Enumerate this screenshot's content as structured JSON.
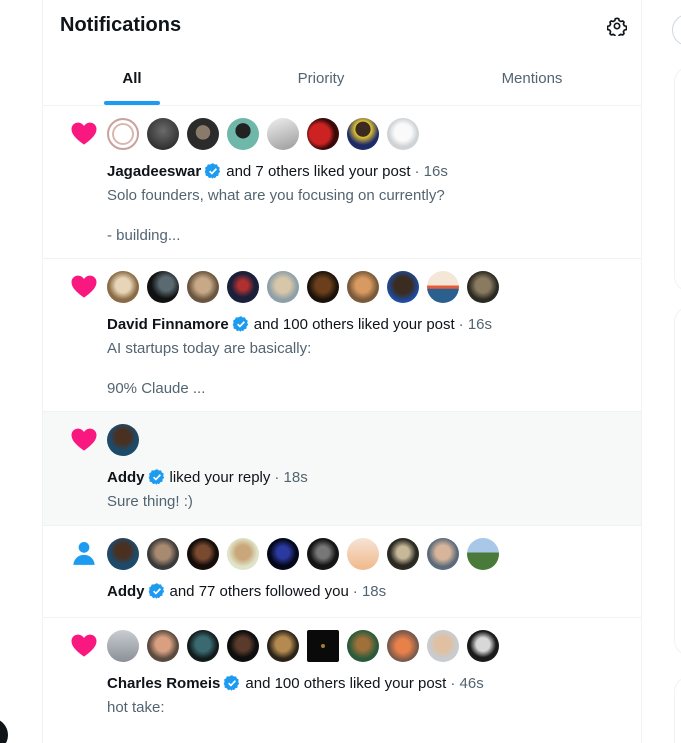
{
  "header": {
    "title": "Notifications",
    "settings_icon": "gear-icon"
  },
  "tabs": [
    {
      "label": "All",
      "active": true
    },
    {
      "label": "Priority",
      "active": false
    },
    {
      "label": "Mentions",
      "active": false
    }
  ],
  "colors": {
    "accent": "#1d9bf0",
    "like": "#f91880",
    "text": "#0f1419",
    "muted": "#536471"
  },
  "notifications": [
    {
      "icon": "heart-icon",
      "name": "Jagadeeswar",
      "verified": true,
      "action": "and 7 others liked your post",
      "time": "· 16s",
      "excerpt1": "Solo founders, what are you focusing on currently?",
      "excerpt2": "- building..."
    },
    {
      "icon": "heart-icon",
      "name": "David Finnamore",
      "verified": true,
      "action": "and 100 others liked your post",
      "time": "· 16s",
      "excerpt1": "AI startups today are basically:",
      "excerpt2": "90% Claude ..."
    },
    {
      "icon": "heart-icon",
      "name": "Addy",
      "verified": true,
      "action": "liked your reply",
      "time": "· 18s",
      "excerpt1": "Sure thing! :)"
    },
    {
      "icon": "person-icon",
      "name": "Addy",
      "verified": true,
      "action": "and 77 others followed you",
      "time": "· 18s"
    },
    {
      "icon": "heart-icon",
      "name": "Charles Romeis",
      "verified": true,
      "action": "and 100 others liked your post",
      "time": "· 46s",
      "excerpt1": "hot take:"
    }
  ]
}
